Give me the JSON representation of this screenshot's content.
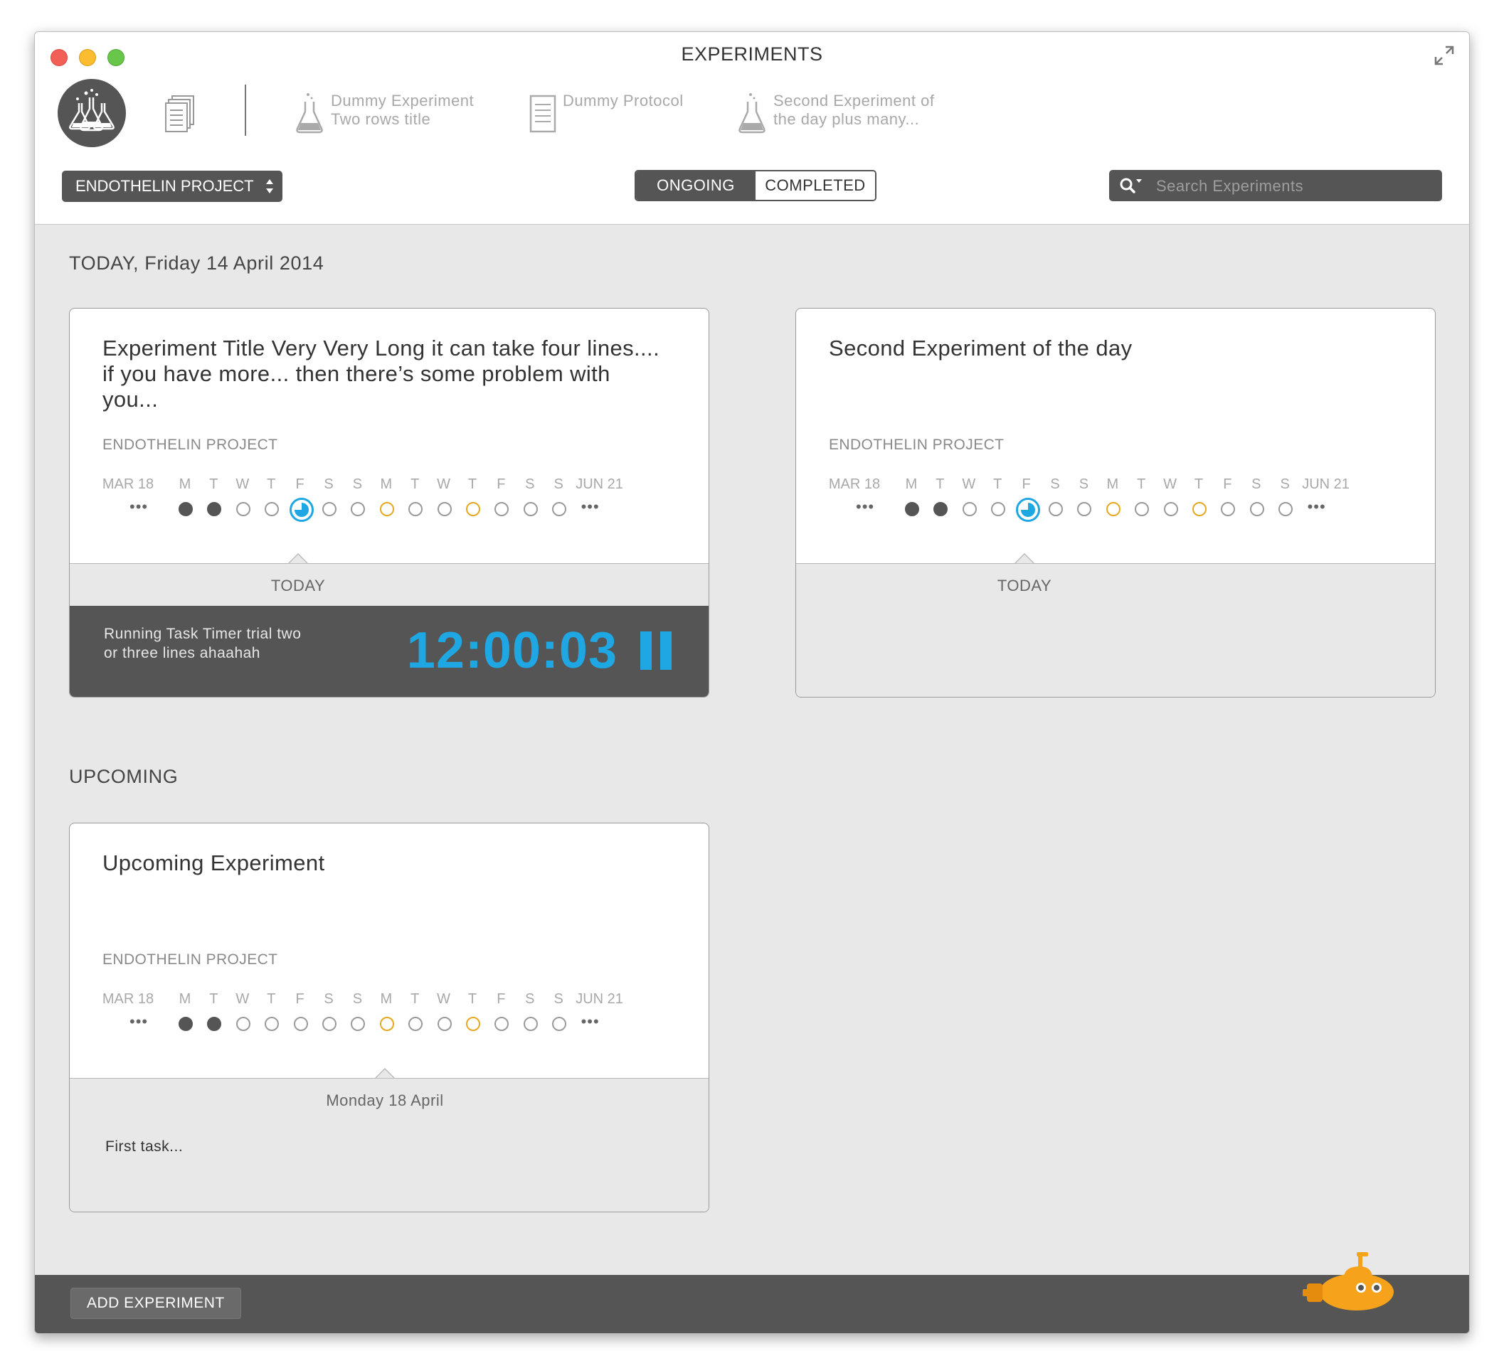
{
  "window": {
    "title": "EXPERIMENTS"
  },
  "toolbar": {
    "recent": [
      {
        "icon": "flask-icon",
        "line1": "Dummy Experiment",
        "line2": "Two rows title"
      },
      {
        "icon": "document-icon",
        "line1": "Dummy Protocol",
        "line2": ""
      },
      {
        "icon": "flask-icon",
        "line1": "Second Experiment of",
        "line2": "the day plus many..."
      }
    ],
    "project_select": "ENDOTHELIN PROJECT",
    "tabs": {
      "ongoing": "ONGOING",
      "completed": "COMPLETED",
      "selected": "ONGOING"
    },
    "search_placeholder": "Search Experiments"
  },
  "sections": {
    "today": "TODAY, Friday 14 April 2014",
    "upcoming": "UPCOMING"
  },
  "timeline": {
    "start": "MAR 18",
    "end": "JUN 21",
    "days": [
      "M",
      "T",
      "W",
      "T",
      "F",
      "S",
      "S",
      "M",
      "T",
      "W",
      "T",
      "F",
      "S",
      "S"
    ],
    "states": [
      "filled",
      "filled",
      "empty",
      "empty",
      "today",
      "empty",
      "empty",
      "yellow",
      "empty",
      "empty",
      "yellow",
      "empty",
      "empty",
      "empty"
    ]
  },
  "cards": [
    {
      "title": "Experiment Title Very Very Long it can take four lines.... if you have more... then there’s some problem with you...",
      "project": "ENDOTHELIN PROJECT",
      "day_label": "TODAY",
      "timer": {
        "task": "Running Task Timer trial two or three lines ahaahah",
        "time": "12:00:03"
      }
    },
    {
      "title": "Second Experiment of the day",
      "project": "ENDOTHELIN PROJECT",
      "day_label": "TODAY"
    },
    {
      "title": "Upcoming Experiment",
      "project": "ENDOTHELIN PROJECT",
      "day_label": "Monday 18 April",
      "task": "First task..."
    }
  ],
  "footer": {
    "add_button": "ADD EXPERIMENT"
  },
  "colors": {
    "accent_blue": "#1ea7e2",
    "dark_gray": "#555555",
    "warning_yellow": "#e5a823",
    "mascot_orange": "#f7a21b"
  }
}
